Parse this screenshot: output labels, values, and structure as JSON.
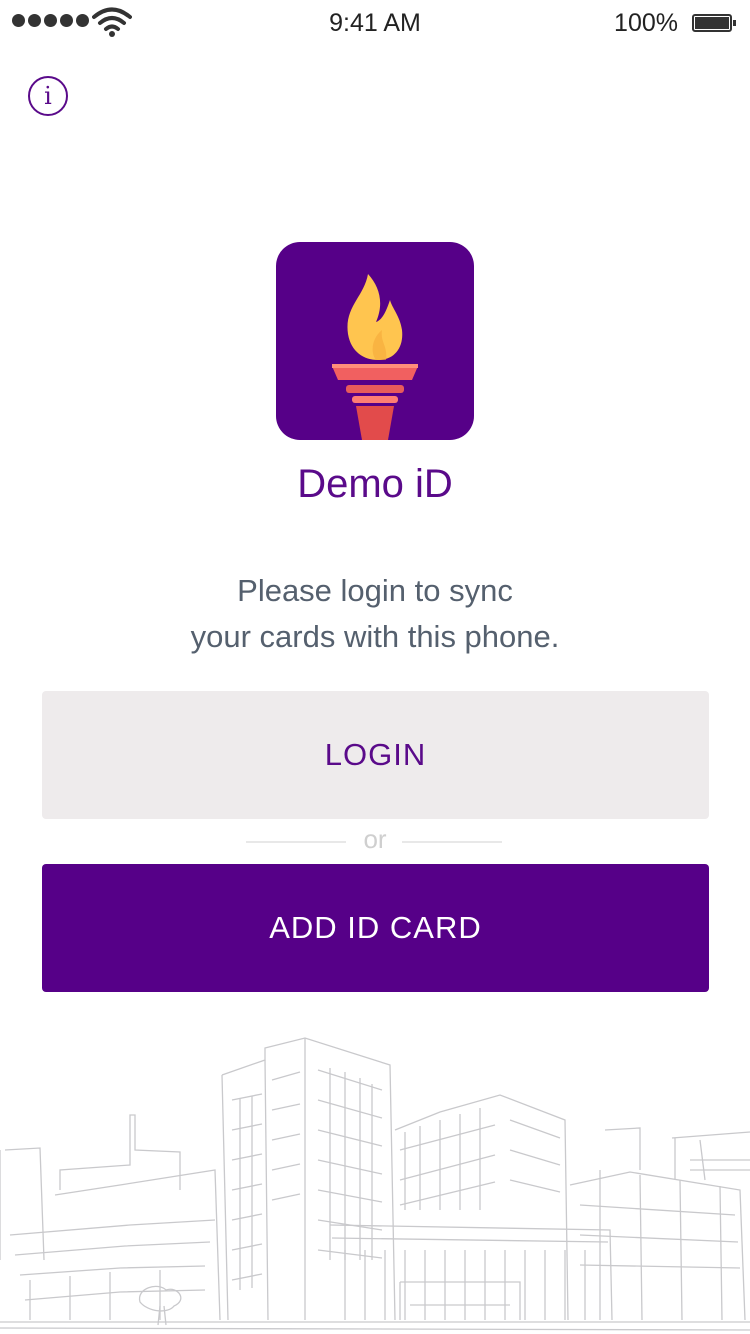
{
  "status_bar": {
    "time": "9:41 AM",
    "battery_percent": "100%",
    "signal_icon": "signal-dots-icon",
    "wifi_icon": "wifi-icon",
    "battery_icon": "battery-icon"
  },
  "header": {
    "info_icon": "info-icon",
    "info_glyph": "i"
  },
  "app": {
    "name": "Demo iD",
    "icon": "torch-icon",
    "icon_background": "#560088",
    "flame_color": "#ffc54f",
    "torch_color": "#e24b4b"
  },
  "main": {
    "prompt_line1": "Please login to sync",
    "prompt_line2": "your cards with this phone.",
    "login_label": "LOGIN",
    "or_label": "or",
    "add_card_label": "ADD ID CARD"
  },
  "colors": {
    "brand_purple": "#560088",
    "login_bg": "#eeebec",
    "text_gray": "#55606e"
  }
}
